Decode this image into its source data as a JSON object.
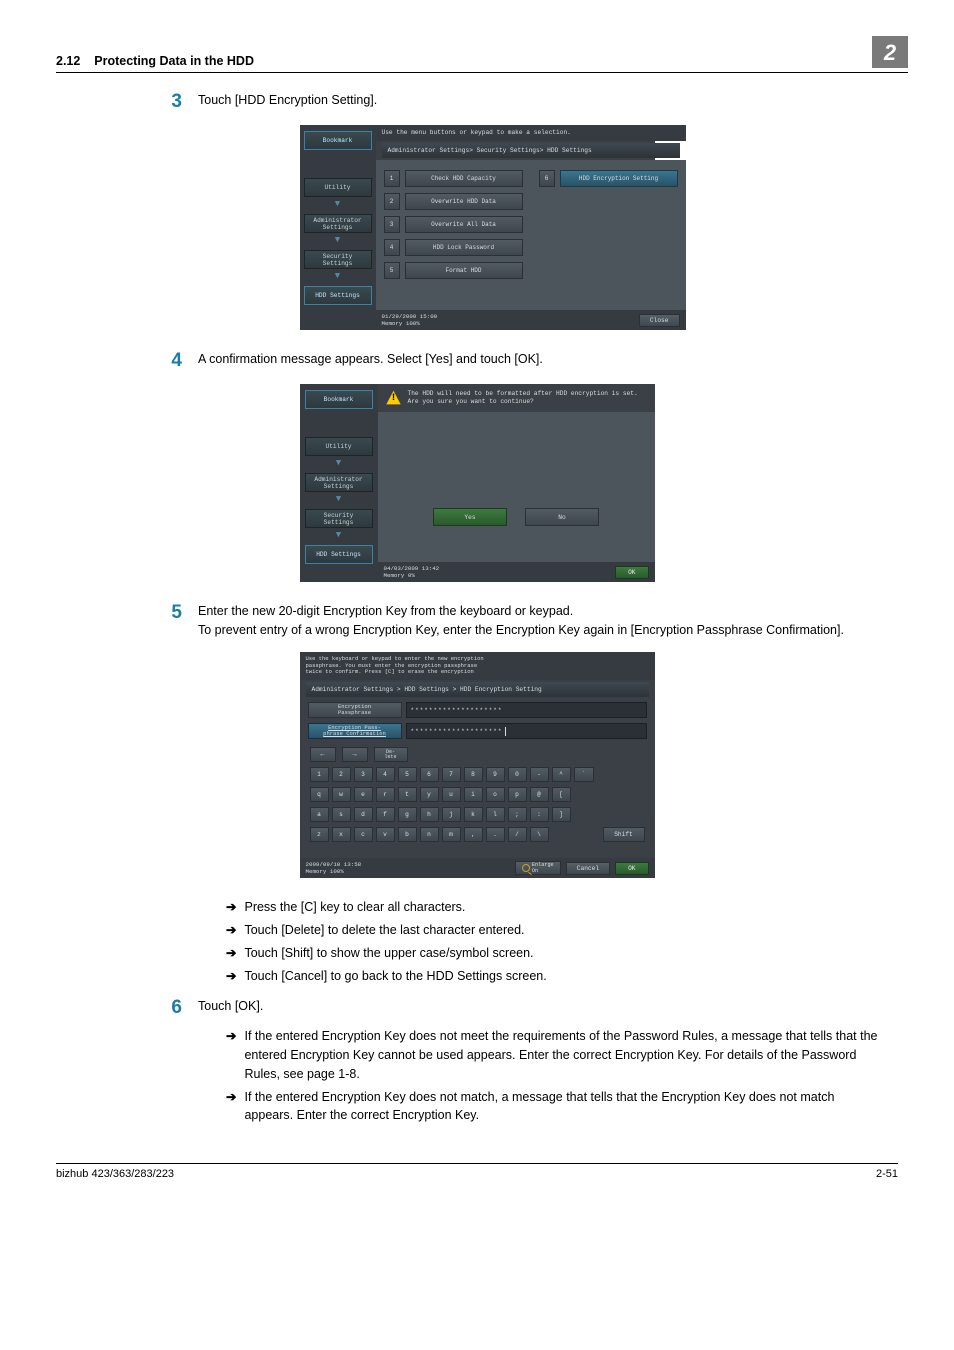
{
  "header": {
    "section": "2.12",
    "title": "Protecting Data in the HDD",
    "chapter": "2"
  },
  "step3": {
    "num": "3",
    "body": "Touch [HDD Encryption Setting]."
  },
  "step4": {
    "num": "4",
    "body": "A confirmation message appears. Select [Yes] and touch [OK]."
  },
  "step5": {
    "num": "5",
    "body1": "Enter the new 20-digit Encryption Key from the keyboard or keypad.",
    "body2": "To prevent entry of a wrong Encryption Key, enter the Encryption Key again in [Encryption Passphrase Confirmation]."
  },
  "step6": {
    "num": "6",
    "body": "Touch [OK]."
  },
  "bullets5": {
    "b1": "Press the [C] key to clear all characters.",
    "b2": "Touch [Delete] to delete the last character entered.",
    "b3": "Touch [Shift] to show the upper case/symbol screen.",
    "b4": "Touch [Cancel] to go back to the HDD Settings screen."
  },
  "bullets6": {
    "b1": "If the entered Encryption Key does not meet the requirements of the Password Rules, a message that tells that the entered Encryption Key cannot be used appears. Enter the correct Encryption Key. For details of the Password Rules, see page 1-8.",
    "b2": "If the entered Encryption Key does not match, a message that tells that the Encryption Key does not match appears. Enter the correct Encryption Key."
  },
  "panel1": {
    "hint": "Use the menu buttons or keypad to make a selection.",
    "breadcrumb": "Administrator Settings> Security Settings> HDD Settings",
    "side": {
      "bookmark": "Bookmark",
      "utility": "Utility",
      "admin": "Administrator\nSettings",
      "security": "Security\nSettings",
      "hdd": "HDD Settings"
    },
    "items": {
      "n1": "1",
      "l1": "Check HDD Capacity",
      "n2": "2",
      "l2": "Overwrite HDD Data",
      "n3": "3",
      "l3": "Overwrite All Data",
      "n4": "4",
      "l4": "HDD Lock Password",
      "n5": "5",
      "l5": "Format HDD",
      "n6": "6",
      "l6": "HDD Encryption Setting"
    },
    "footer": {
      "left": "01/29/2009  15:00\nMemory     100%",
      "close": "Close"
    }
  },
  "panel2": {
    "warn": "The HDD will need to be formatted after HDD encryption is set.\nAre you sure you want to continue?",
    "side": {
      "bookmark": "Bookmark",
      "utility": "Utility",
      "admin": "Administrator\nSettings",
      "security": "Security\nSettings",
      "hdd": "HDD Settings"
    },
    "yes": "Yes",
    "no": "No",
    "footer": {
      "left": "04/03/2009  13:42\nMemory      0%",
      "ok": "OK"
    }
  },
  "panel3": {
    "hint": "Use the keyboard or keypad to enter the new encryption\npassphrase. You must enter the encryption passphrase\ntwice to confirm. Press [C] to erase the encryption",
    "breadcrumb": "Administrator Settings > HDD Settings > HDD Encryption Setting",
    "field1_label": "Encryption\nPassphrase",
    "field2_label": "Encryption Pass-\nphrase Confirmation",
    "value": "********************",
    "delete": "De-\nlete",
    "row1": [
      "1",
      "2",
      "3",
      "4",
      "5",
      "6",
      "7",
      "8",
      "9",
      "0",
      "-",
      "^"
    ],
    "row2": [
      "q",
      "w",
      "e",
      "r",
      "t",
      "y",
      "u",
      "i",
      "o",
      "p",
      "@",
      "["
    ],
    "row3": [
      "a",
      "s",
      "d",
      "f",
      "g",
      "h",
      "j",
      "k",
      "l",
      ";",
      ":",
      "]"
    ],
    "row4": [
      "z",
      "x",
      "c",
      "v",
      "b",
      "n",
      "m",
      ",",
      ".",
      "/",
      "\\"
    ],
    "shift": "Shift",
    "footer": {
      "left": "2009/09/10  13:58\nMemory     100%",
      "enlarge": "Enlarge\nOn",
      "cancel": "Cancel",
      "ok": "OK"
    }
  },
  "pagefoot": {
    "model": "bizhub 423/363/283/223",
    "pageno": "2-51"
  }
}
